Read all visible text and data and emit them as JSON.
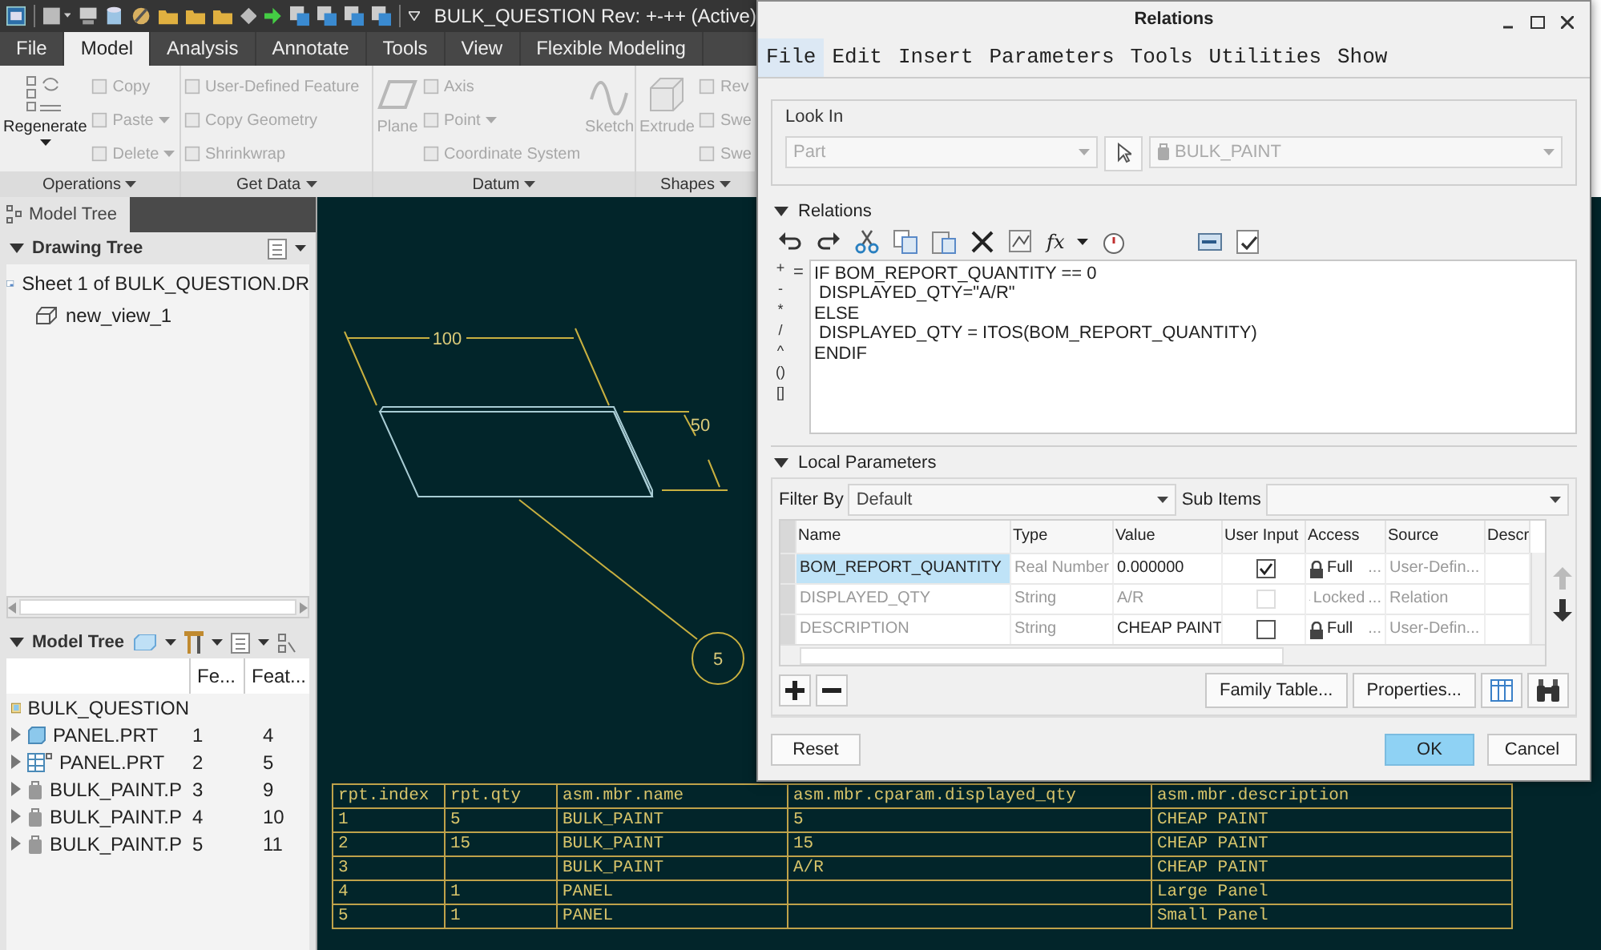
{
  "quick_access": {
    "title": "BULK_QUESTION Rev: +-++ (Active)"
  },
  "ribbon_tabs": [
    {
      "label": "File",
      "selected": false
    },
    {
      "label": "Model",
      "selected": true
    },
    {
      "label": "Analysis",
      "selected": false
    },
    {
      "label": "Annotate",
      "selected": false
    },
    {
      "label": "Tools",
      "selected": false
    },
    {
      "label": "View",
      "selected": false
    },
    {
      "label": "Flexible Modeling",
      "selected": false
    }
  ],
  "ribbon_groups": [
    {
      "label": "Operations",
      "items": [
        {
          "label": "Regenerate",
          "kind": "large",
          "disabled": false,
          "dropdown": true
        },
        {
          "label": "Copy",
          "kind": "small",
          "disabled": true,
          "dropdown": false
        },
        {
          "label": "Paste",
          "kind": "small",
          "disabled": true,
          "dropdown": true
        },
        {
          "label": "Delete",
          "kind": "small",
          "disabled": true,
          "dropdown": true
        }
      ]
    },
    {
      "label": "Get Data",
      "items": [
        {
          "label": "User-Defined Feature",
          "kind": "small",
          "disabled": true,
          "dropdown": false
        },
        {
          "label": "Copy Geometry",
          "kind": "small",
          "disabled": true,
          "dropdown": false
        },
        {
          "label": "Shrinkwrap",
          "kind": "small",
          "disabled": true,
          "dropdown": false
        }
      ]
    },
    {
      "label": "Datum",
      "items": [
        {
          "label": "Plane",
          "kind": "large",
          "disabled": true,
          "dropdown": false
        },
        {
          "label": "Axis",
          "kind": "small",
          "disabled": true,
          "dropdown": false
        },
        {
          "label": "Point",
          "kind": "small",
          "disabled": true,
          "dropdown": true
        },
        {
          "label": "Coordinate System",
          "kind": "small",
          "disabled": true,
          "dropdown": false
        },
        {
          "label": "Sketch",
          "kind": "large",
          "disabled": true,
          "dropdown": false
        }
      ]
    },
    {
      "label": "Shapes",
      "items": [
        {
          "label": "Extrude",
          "kind": "large",
          "disabled": true,
          "dropdown": false
        },
        {
          "label": "Rev",
          "kind": "small",
          "disabled": true,
          "dropdown": false
        },
        {
          "label": "Swe",
          "kind": "small",
          "disabled": true,
          "dropdown": false
        },
        {
          "label": "Swe",
          "kind": "small",
          "disabled": true,
          "dropdown": false
        }
      ]
    }
  ],
  "panel_tab": {
    "label": "Model Tree"
  },
  "drawing_tree": {
    "title": "Drawing Tree",
    "items": [
      {
        "label": "Sheet 1 of BULK_QUESTION.DR",
        "children": [
          {
            "label": "new_view_1"
          }
        ]
      }
    ]
  },
  "model_tree": {
    "title": "Model Tree",
    "columns": [
      "Fe...",
      "Feat..."
    ],
    "root": {
      "label": "BULK_QUESTION",
      "children": [
        {
          "label": "PANEL.PRT",
          "kind": "part",
          "expanded": false,
          "col_1": "1",
          "col_2": "4"
        },
        {
          "label": "PANEL.PRT",
          "kind": "family",
          "expanded": false,
          "col_1": "2",
          "col_2": "5"
        },
        {
          "label": "BULK_PAINT.P",
          "kind": "bulk",
          "expanded": false,
          "col_1": "3",
          "col_2": "9"
        },
        {
          "label": "BULK_PAINT.P",
          "kind": "bulk",
          "expanded": false,
          "col_1": "4",
          "col_2": "10"
        },
        {
          "label": "BULK_PAINT.P",
          "kind": "bulk",
          "expanded": false,
          "col_1": "5",
          "col_2": "11"
        }
      ]
    }
  },
  "drawing": {
    "width_dimension": "100",
    "depth_dimension": "50",
    "balloon": "5"
  },
  "bom_table": {
    "columns": [
      "rpt.index",
      "rpt.qty",
      "asm.mbr.name",
      "asm.mbr.cparam.displayed_qty",
      "asm.mbr.description"
    ],
    "rows": [
      [
        "1",
        "5",
        "BULK_PAINT",
        "5",
        "CHEAP PAINT"
      ],
      [
        "2",
        "15",
        "BULK_PAINT",
        "15",
        "CHEAP PAINT"
      ],
      [
        "3",
        "",
        "BULK_PAINT",
        "A/R",
        "CHEAP PAINT"
      ],
      [
        "4",
        "1",
        "PANEL",
        "",
        "Large Panel"
      ],
      [
        "5",
        "1",
        "PANEL",
        "",
        "Small Panel"
      ]
    ]
  },
  "relations_dialog": {
    "title": "Relations",
    "menu": [
      {
        "label": "File",
        "selected": true
      },
      {
        "label": "Edit",
        "selected": false
      },
      {
        "label": "Insert",
        "selected": false
      },
      {
        "label": "Parameters",
        "selected": false
      },
      {
        "label": "Tools",
        "selected": false
      },
      {
        "label": "Utilities",
        "selected": false
      },
      {
        "label": "Show",
        "selected": false
      }
    ],
    "look_in": {
      "label": "Look In",
      "type": "Part",
      "model": "BULK_PAINT"
    },
    "relations_label": "Relations",
    "function_button": "fx",
    "operators": [
      "+",
      "-",
      "*",
      "/",
      "^",
      "()",
      "[]"
    ],
    "equals": "=",
    "relations": [
      "IF BOM_REPORT_QUANTITY == 0",
      " DISPLAYED_QTY=\"A/R\"",
      "ELSE",
      " DISPLAYED_QTY = ITOS(BOM_REPORT_QUANTITY)",
      "ENDIF"
    ],
    "local_parameters_label": "Local Parameters",
    "filter_label": "Filter By",
    "filter_value": "Default",
    "sub_items_label": "Sub Items",
    "columns": [
      "Name",
      "Type",
      "Value",
      "User Input",
      "Access",
      "Source",
      "Descr"
    ],
    "parameters": [
      {
        "name": "BOM_REPORT_QUANTITY",
        "type": "Real Number",
        "value": "0.000000",
        "user_input": true,
        "access": "Full",
        "access_more": "...",
        "source": "User-Defin...",
        "selected": true,
        "disabled": false
      },
      {
        "name": "DISPLAYED_QTY",
        "type": "String",
        "value": "A/R",
        "user_input": false,
        "access": "Locked",
        "access_more": "...",
        "source": "Relation",
        "selected": false,
        "disabled": true
      },
      {
        "name": "DESCRIPTION",
        "type": "String",
        "value": "CHEAP PAINT",
        "user_input": false,
        "access": "Full",
        "access_more": "...",
        "source": "User-Defin...",
        "selected": false,
        "disabled": false
      }
    ],
    "table_buttons": [
      "Family Table...",
      "Properties..."
    ],
    "buttons": [
      {
        "label": "Reset",
        "kind": "normal"
      },
      {
        "label": "OK",
        "kind": "primary"
      },
      {
        "label": "Cancel",
        "kind": "normal"
      }
    ]
  }
}
